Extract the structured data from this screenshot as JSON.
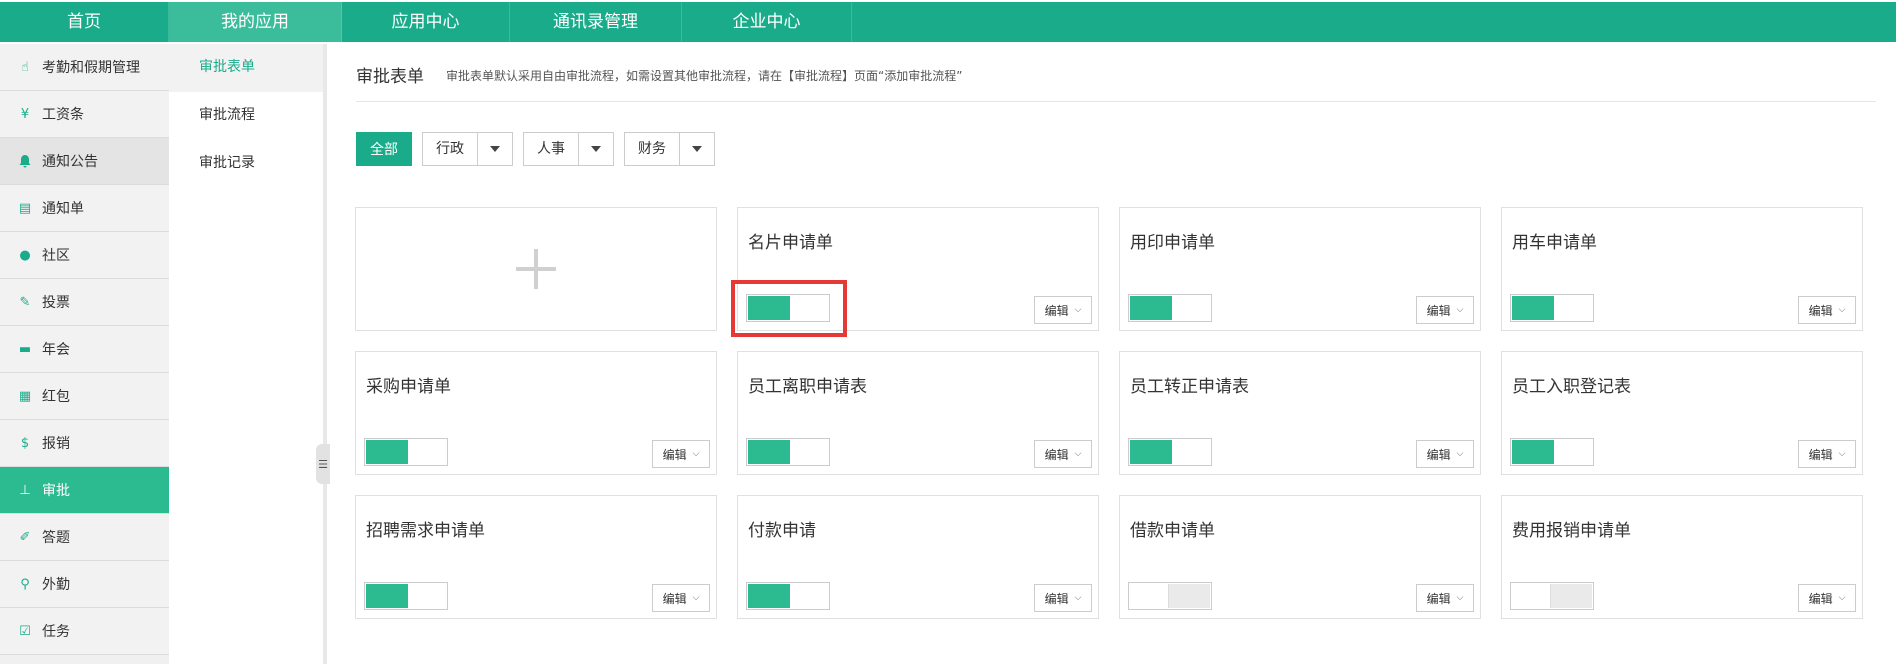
{
  "topnav": [
    "首页",
    "我的应用",
    "应用中心",
    "通讯录管理",
    "企业中心"
  ],
  "sidebar": [
    {
      "label": "考勤和假期管理",
      "icon": "hand-icon",
      "glyph": "☝"
    },
    {
      "label": "工资条",
      "icon": "yen-icon",
      "glyph": "¥"
    },
    {
      "label": "通知公告",
      "icon": "bell-icon",
      "glyph": "🔔"
    },
    {
      "label": "通知单",
      "icon": "document-icon",
      "glyph": "▤"
    },
    {
      "label": "社区",
      "icon": "chat-icon",
      "glyph": "●"
    },
    {
      "label": "投票",
      "icon": "vote-icon",
      "glyph": "✎"
    },
    {
      "label": "年会",
      "icon": "flag-icon",
      "glyph": "▬"
    },
    {
      "label": "红包",
      "icon": "red-envelope-icon",
      "glyph": "▦"
    },
    {
      "label": "报销",
      "icon": "money-icon",
      "glyph": "$"
    },
    {
      "label": "审批",
      "icon": "stamp-icon",
      "glyph": "⊥"
    },
    {
      "label": "答题",
      "icon": "quiz-icon",
      "glyph": "✐"
    },
    {
      "label": "外勤",
      "icon": "location-icon",
      "glyph": "⚲"
    },
    {
      "label": "任务",
      "icon": "clipboard-icon",
      "glyph": "☑"
    }
  ],
  "subnav": [
    "审批表单",
    "审批流程",
    "审批记录"
  ],
  "header": {
    "title": "审批表单",
    "desc": "审批表单默认采用自由审批流程，如需设置其他审批流程，请在【审批流程】页面“添加审批流程”"
  },
  "filters": {
    "all": "全部",
    "dropdowns": [
      "行政",
      "人事",
      "财务"
    ]
  },
  "edit_label": "编辑",
  "cards": [
    {
      "name": "名片申请单",
      "enabled": true
    },
    {
      "name": "用印申请单",
      "enabled": true
    },
    {
      "name": "用车申请单",
      "enabled": true
    },
    {
      "name": "采购申请单",
      "enabled": true
    },
    {
      "name": "员工离职申请表",
      "enabled": true
    },
    {
      "name": "员工转正申请表",
      "enabled": true
    },
    {
      "name": "员工入职登记表",
      "enabled": true
    },
    {
      "name": "招聘需求申请单",
      "enabled": true
    },
    {
      "name": "付款申请",
      "enabled": true
    },
    {
      "name": "借款申请单",
      "enabled": false
    },
    {
      "name": "费用报销申请单",
      "enabled": false
    }
  ],
  "colors": {
    "accent": "#1aac8a",
    "highlight": "#e53935"
  }
}
